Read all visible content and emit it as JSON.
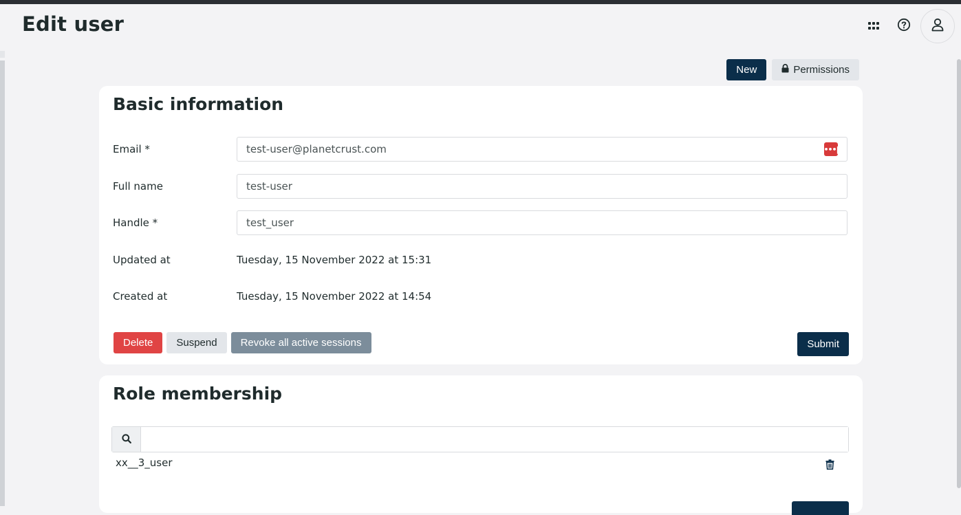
{
  "header": {
    "title": "Edit user",
    "icons": [
      "apps-grid-icon",
      "help-icon",
      "user-icon"
    ]
  },
  "toolbar": {
    "new_label": "New",
    "permissions_label": "Permissions"
  },
  "basic": {
    "title": "Basic information",
    "email_label": "Email *",
    "email_value": "test-user@planetcrust.com",
    "fullname_label": "Full name",
    "fullname_value": "test-user",
    "handle_label": "Handle *",
    "handle_value": "test_user",
    "updated_label": "Updated at",
    "updated_value": "Tuesday, 15 November 2022 at 15:31",
    "created_label": "Created at",
    "created_value": "Tuesday, 15 November 2022 at 14:54",
    "delete_label": "Delete",
    "suspend_label": "Suspend",
    "revoke_label": "Revoke all active sessions",
    "submit_label": "Submit"
  },
  "roles": {
    "title": "Role membership",
    "search_value": "",
    "items": [
      {
        "name": "xx__3_user"
      }
    ]
  },
  "colors": {
    "primary": "#0b2e4a",
    "danger": "#e04444",
    "secondary": "#7c8d9b",
    "background": "#f3f3f5"
  }
}
